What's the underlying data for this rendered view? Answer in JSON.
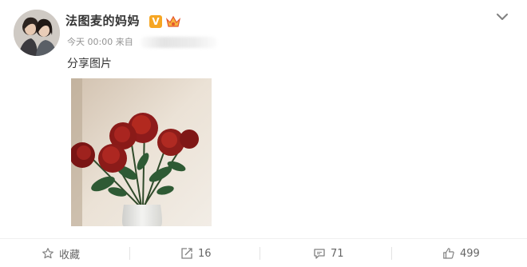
{
  "author": {
    "name": "法图麦的妈妈",
    "verified_badge": "V"
  },
  "meta": {
    "time": "今天 00:00",
    "source_prefix": "来自"
  },
  "post": {
    "text": "分享图片"
  },
  "actions": {
    "favorite_label": "收藏",
    "repost_count": "16",
    "comment_count": "71",
    "like_count": "499"
  },
  "colors": {
    "badge": "#f6a623",
    "text": "#333333",
    "muted": "#939393"
  }
}
